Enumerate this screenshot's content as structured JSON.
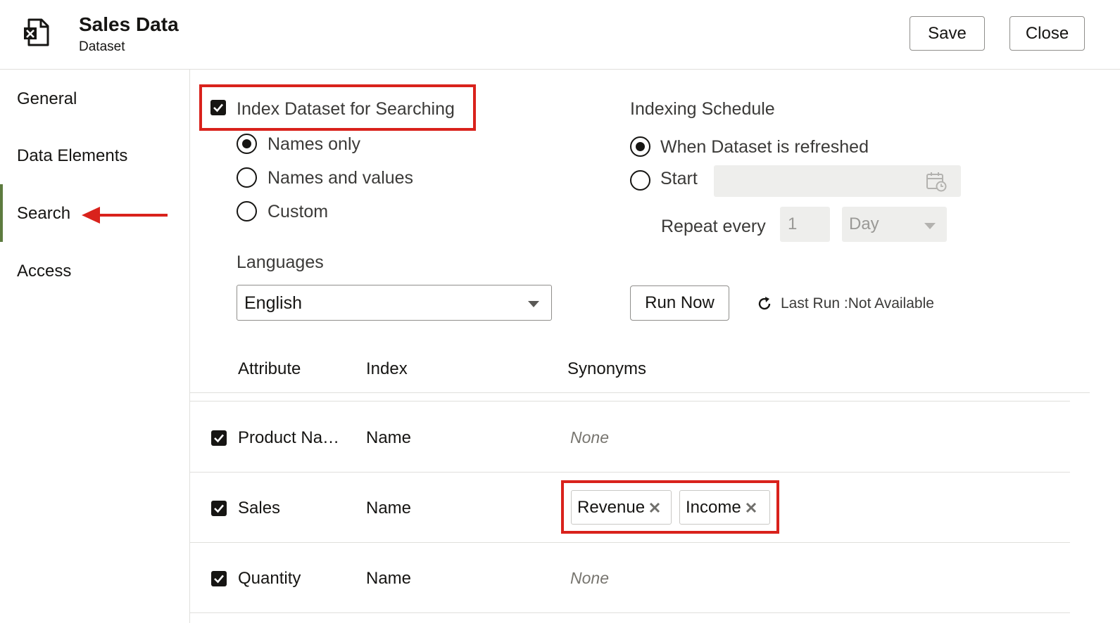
{
  "header": {
    "file_icon": "excel-file-icon",
    "title": "Sales Data",
    "subtitle": "Dataset",
    "save_label": "Save",
    "close_label": "Close"
  },
  "sidebar": {
    "items": [
      {
        "label": "General",
        "active": false
      },
      {
        "label": "Data Elements",
        "active": false
      },
      {
        "label": "Search",
        "active": true
      },
      {
        "label": "Access",
        "active": false
      }
    ],
    "accent_color": "#5d7b3f"
  },
  "search": {
    "index_checkbox_label": "Index Dataset for Searching",
    "index_checked": true,
    "index_options": [
      {
        "label": "Names only",
        "selected": true
      },
      {
        "label": "Names and values",
        "selected": false
      },
      {
        "label": "Custom",
        "selected": false
      }
    ],
    "languages_label": "Languages",
    "language_value": "English"
  },
  "schedule": {
    "title": "Indexing Schedule",
    "options": [
      {
        "label": "When Dataset is refreshed",
        "selected": true
      },
      {
        "label": "Start",
        "selected": false
      }
    ],
    "start_value": "",
    "repeat_label": "Repeat every",
    "repeat_value": "1",
    "repeat_unit": "Day",
    "run_now_label": "Run Now",
    "last_run_text": "Last Run :Not Available"
  },
  "table": {
    "headers": {
      "attribute": "Attribute",
      "index": "Index",
      "synonyms": "Synonyms"
    },
    "rows": [
      {
        "checked": true,
        "attribute": "Product Na…",
        "index": "Name",
        "synonyms_none": "None",
        "synonyms": []
      },
      {
        "checked": true,
        "attribute": "Sales",
        "index": "Name",
        "synonyms_none": "",
        "synonyms": [
          "Revenue",
          "Income"
        ]
      },
      {
        "checked": true,
        "attribute": "Quantity",
        "index": "Name",
        "synonyms_none": "None",
        "synonyms": []
      }
    ]
  },
  "annotations": {
    "highlight_color": "#d9221c"
  }
}
